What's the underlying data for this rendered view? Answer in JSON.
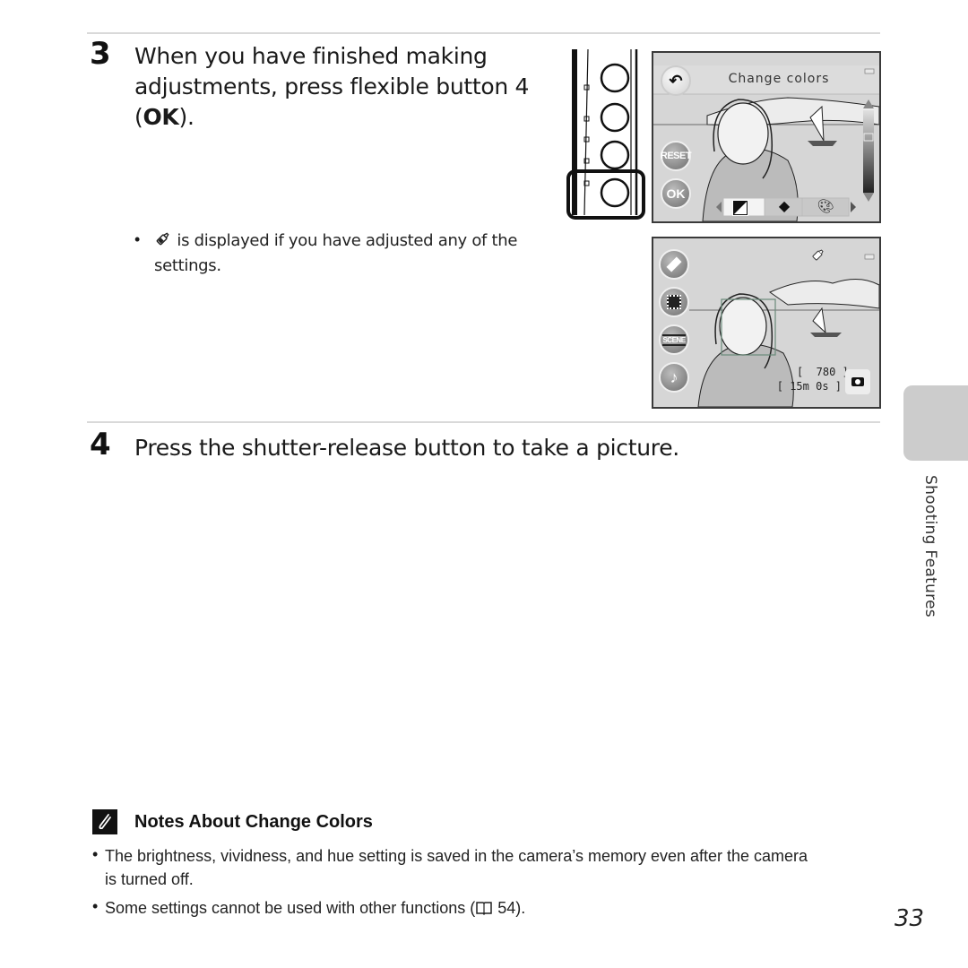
{
  "step3": {
    "number": "3",
    "line1": "When you have finished making",
    "line2": "adjustments, press flexible button 4",
    "line3_open": "(",
    "line3_ok": "OK",
    "line3_close": ").",
    "bullet_icon": "color-adjusted-icon",
    "bullet_text_line1": " is displayed if you have adjusted any of the",
    "bullet_text_line2": "settings."
  },
  "screen1": {
    "title": "Change colors",
    "back_icon": "back-arrow-icon",
    "reset_label": "RESET",
    "ok_label": "OK",
    "tabs": [
      {
        "icon": "brightness-icon",
        "selected": true
      },
      {
        "icon": "vividness-icon",
        "selected": false
      },
      {
        "icon": "hue-palette-icon",
        "selected": false
      }
    ]
  },
  "screen2": {
    "shots_remaining": "[  780 ]",
    "movie_time": "[ 15m 0s ]",
    "side_buttons": [
      {
        "icon": "color-adjust-icon"
      },
      {
        "icon": "frame-icon"
      },
      {
        "icon": "scene-icon",
        "label": "SCENE"
      },
      {
        "icon": "music-note-icon"
      }
    ]
  },
  "step4": {
    "number": "4",
    "text": "Press the shutter-release button to take a picture."
  },
  "side_tab": {
    "label": "Shooting Features"
  },
  "notes": {
    "title": "Notes About Change Colors",
    "items": [
      {
        "line1": "The brightness, vividness, and hue setting is saved in the camera’s memory even after the camera",
        "line2": "is turned off."
      },
      {
        "line1": "Some settings cannot be used with other functions (",
        "ref_icon": "book-reference-icon",
        "ref_page": " 54)."
      }
    ]
  },
  "page_number": "33"
}
